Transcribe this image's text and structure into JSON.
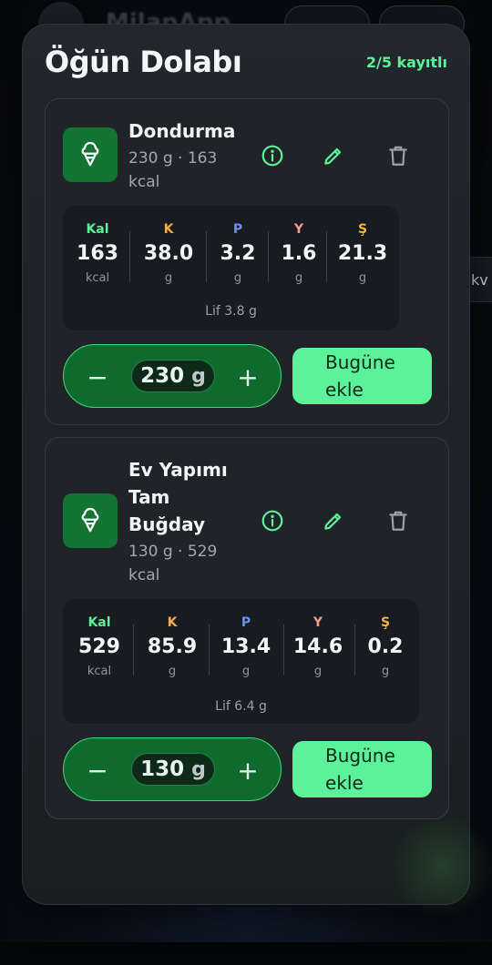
{
  "background": {
    "app_title": "MilanApp",
    "side_fragment": "kv"
  },
  "sheet": {
    "title": "Öğün Dolabı",
    "record_count": "2/5 kayıtlı"
  },
  "colors": {
    "accent": "#5cf29a",
    "calories": "#5cf29a",
    "carbs": "#f5b040",
    "protein": "#6f8ff5",
    "fat": "#f29a8e",
    "sugar": "#f5b040"
  },
  "items": [
    {
      "icon": "ice-cream-icon",
      "name": "Dondurma",
      "meta": "230 g · 163 kcal",
      "nutrients": [
        {
          "label": "Kal",
          "value": "163",
          "unit": "kcal"
        },
        {
          "label": "K",
          "value": "38.0",
          "unit": "g"
        },
        {
          "label": "P",
          "value": "3.2",
          "unit": "g"
        },
        {
          "label": "Y",
          "value": "1.6",
          "unit": "g"
        },
        {
          "label": "Ş",
          "value": "21.3",
          "unit": "g"
        }
      ],
      "fiber": "Lif 3.8 g",
      "quantity": "230",
      "quantity_unit": "g",
      "decrement": "−",
      "increment": "+",
      "add_label": "Bugüne ekle"
    },
    {
      "icon": "ice-cream-icon",
      "name": "Ev Yapımı Tam Buğday",
      "meta": "130 g · 529 kcal",
      "nutrients": [
        {
          "label": "Kal",
          "value": "529",
          "unit": "kcal"
        },
        {
          "label": "K",
          "value": "85.9",
          "unit": "g"
        },
        {
          "label": "P",
          "value": "13.4",
          "unit": "g"
        },
        {
          "label": "Y",
          "value": "14.6",
          "unit": "g"
        },
        {
          "label": "Ş",
          "value": "0.2",
          "unit": "g"
        }
      ],
      "fiber": "Lif 6.4 g",
      "quantity": "130",
      "quantity_unit": "g",
      "decrement": "−",
      "increment": "+",
      "add_label": "Bugüne ekle"
    }
  ]
}
